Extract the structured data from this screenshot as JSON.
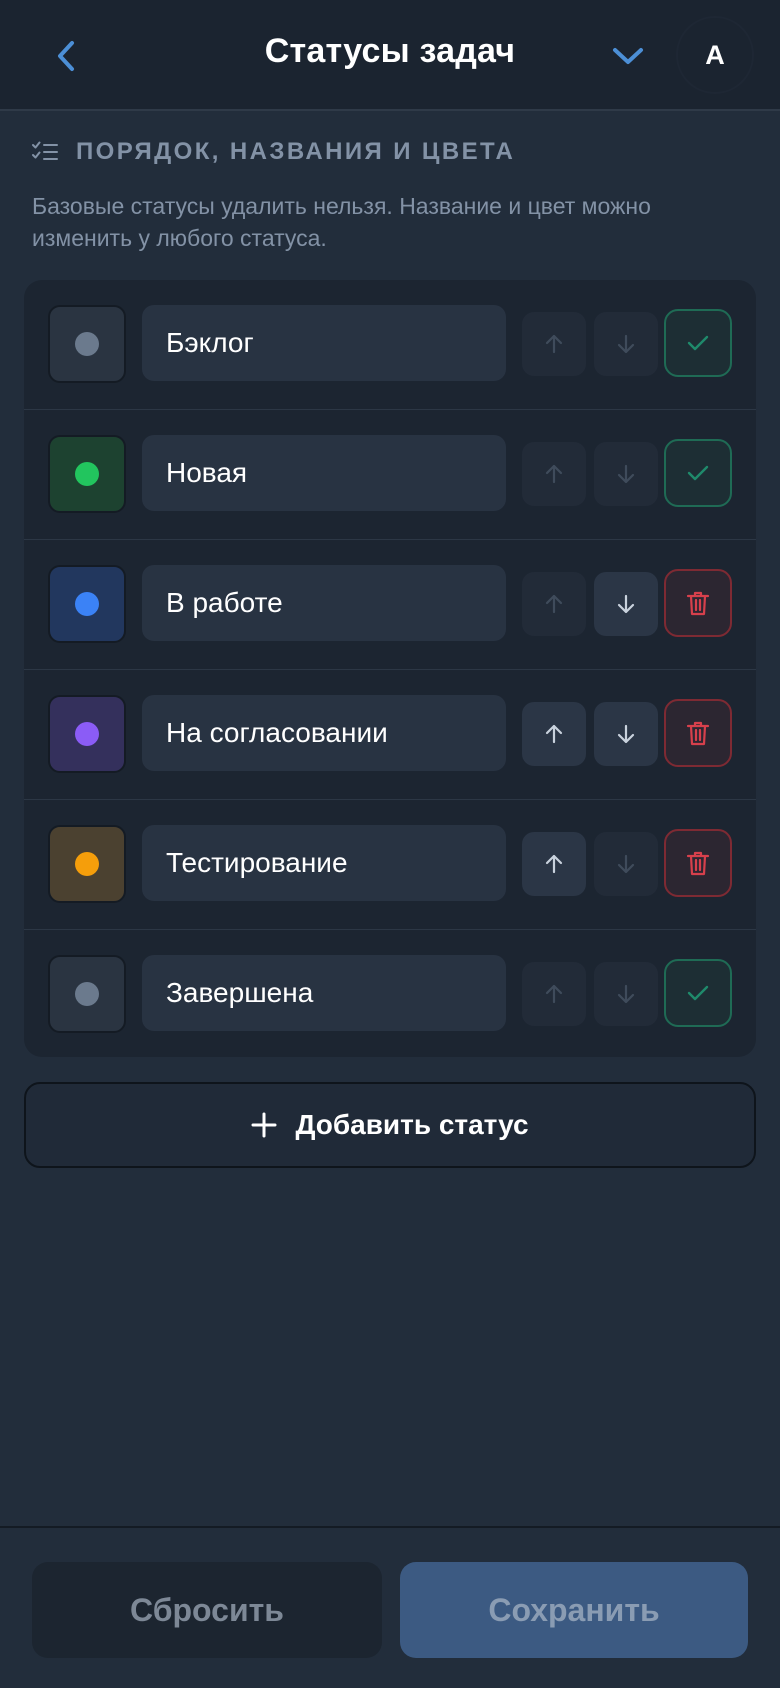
{
  "header": {
    "title": "Статусы задач",
    "avatar_initial": "A"
  },
  "section": {
    "title": "ПОРЯДОК, НАЗВАНИЯ И ЦВЕТА",
    "description": "Базовые статусы удалить нельзя. Название и цвет можно изменить у любого статуса."
  },
  "statuses": [
    {
      "name": "Бэклог",
      "dot_color": "#6b7a8d",
      "swatch_bg": "#2a3441",
      "can_move_up": false,
      "can_move_down": false,
      "action": "base"
    },
    {
      "name": "Новая",
      "dot_color": "#22c55e",
      "swatch_bg": "#1d4230",
      "can_move_up": false,
      "can_move_down": false,
      "action": "base"
    },
    {
      "name": "В работе",
      "dot_color": "#3b82f6",
      "swatch_bg": "#22375e",
      "can_move_up": false,
      "can_move_down": true,
      "action": "delete"
    },
    {
      "name": "На согласовании",
      "dot_color": "#8b5cf6",
      "swatch_bg": "#34305c",
      "can_move_up": true,
      "can_move_down": true,
      "action": "delete"
    },
    {
      "name": "Тестирование",
      "dot_color": "#f59e0b",
      "swatch_bg": "#4b4130",
      "can_move_up": true,
      "can_move_down": false,
      "action": "delete"
    },
    {
      "name": "Завершена",
      "dot_color": "#6b7a8d",
      "swatch_bg": "#2a3441",
      "can_move_up": false,
      "can_move_down": false,
      "action": "base"
    }
  ],
  "add_button": {
    "label": "Добавить статус"
  },
  "footer": {
    "reset_label": "Сбросить",
    "save_label": "Сохранить"
  },
  "colors": {
    "accent": "#4c8fd6",
    "success": "#1f8a6b",
    "danger": "#d7404c"
  },
  "icons": {
    "back": "chevron-left-icon",
    "dropdown": "chevron-down-icon",
    "section": "checklist-icon",
    "move_up": "arrow-up-icon",
    "move_down": "arrow-down-icon",
    "base": "check-icon",
    "delete": "trash-icon",
    "add": "plus-icon"
  }
}
